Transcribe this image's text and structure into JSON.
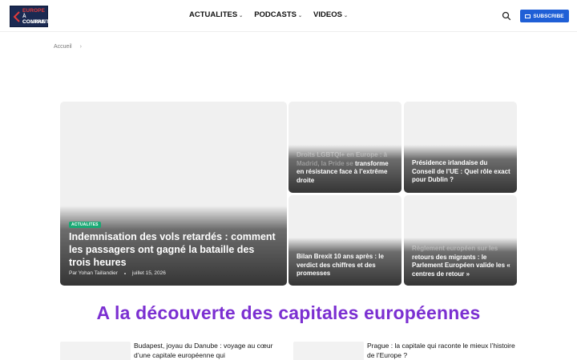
{
  "header": {
    "logo_lines": [
      "EUROPE",
      "À CONTRE",
      "COURANT"
    ],
    "nav": [
      {
        "label": "ACTUALITES"
      },
      {
        "label": "PODCASTS"
      },
      {
        "label": "VIDEOS"
      }
    ],
    "subscribe_label": "SUBSCRIBE"
  },
  "breadcrumb": {
    "home": "Accueil",
    "separator": "›"
  },
  "featured": {
    "badge": "ACTUALITES",
    "title": "Indemnisation des vols retardés : comment les passagers ont gagné la bataille des trois heures",
    "author": "Par Yohan Taillandier",
    "date": "juillet 15, 2026"
  },
  "cards": [
    {
      "title_faint": "Droits LGBTQI+ en Europe : à Madrid, la Pride se",
      "title": "transforme en résistance face à l’extrême droite"
    },
    {
      "title": "Présidence irlandaise du Conseil de l’UE : Quel rôle exact pour Dublin ?"
    },
    {
      "title": "Bilan Brexit 10 ans après : le verdict des chiffres et des promesses"
    },
    {
      "title_faint": "Règlement européen sur les",
      "title": "retours des migrants : le Parlement Européen valide les « centres de retour »"
    }
  ],
  "section": {
    "title": "A la découverte des capitales européennes"
  },
  "articles": [
    {
      "title": "Budapest, joyau du Danube : voyage au cœur d’une capitale européenne qui"
    },
    {
      "title": "Prague : la capitale qui raconte le mieux l’histoire de l’Europe ?"
    }
  ],
  "colors": {
    "subscribe": "#1f5fd6",
    "badge": "#19a974",
    "section_title": "#7b2fd1",
    "logo_bg": "#1b2a52"
  },
  "icons": [
    "search-icon",
    "mail-icon",
    "chevron-down-icon",
    "chevron-right-icon"
  ]
}
